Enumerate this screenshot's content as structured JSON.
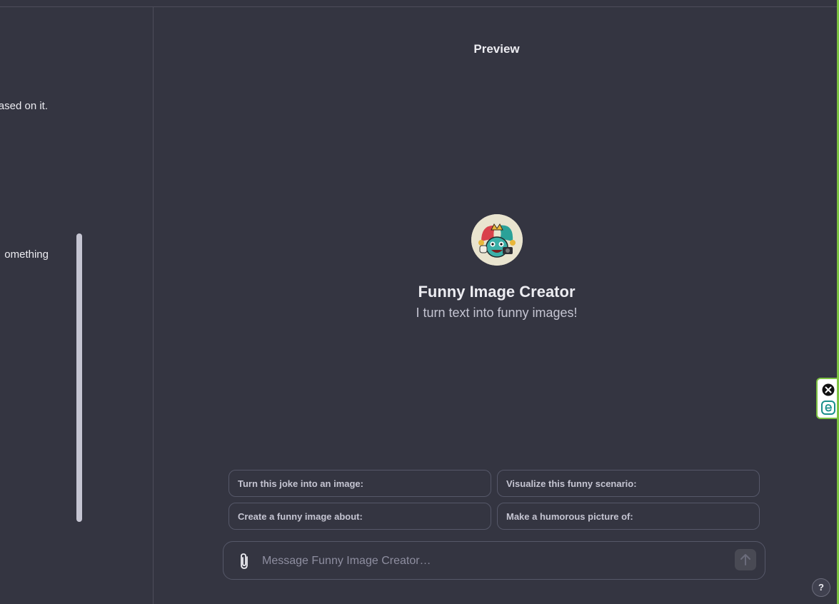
{
  "left_panel": {
    "text_line_1": "ased on it.",
    "text_line_2": "omething"
  },
  "preview": {
    "title": "Preview",
    "gpt_name": "Funny Image Creator",
    "gpt_description": "I turn text into funny images!",
    "avatar_icon": "jester-avatar-icon"
  },
  "suggestions": [
    {
      "label": "Turn this joke into an image:"
    },
    {
      "label": "Visualize this funny scenario:"
    },
    {
      "label": "Create a funny image about:"
    },
    {
      "label": "Make a humorous picture of:"
    }
  ],
  "composer": {
    "placeholder": "Message Funny Image Creator…",
    "attach_icon": "paperclip-icon",
    "send_icon": "arrow-up-icon"
  },
  "extension_widget": {
    "close_icon": "close-circle-icon",
    "app_icon": "e-logo-icon"
  },
  "help_button": {
    "label": "?"
  },
  "colors": {
    "background": "#343541",
    "border": "#565869",
    "text_primary": "#ececf1",
    "text_secondary": "#c5c5d2",
    "extension_accent": "#7dc242"
  }
}
